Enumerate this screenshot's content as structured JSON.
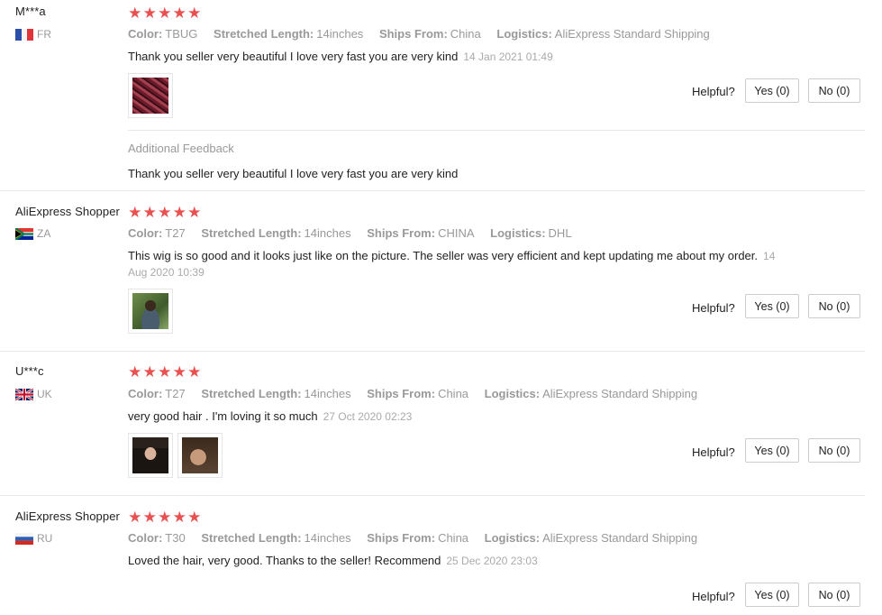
{
  "colors": {
    "star": "#e95151",
    "muted": "#999999",
    "text": "#222222"
  },
  "helpful_label": "Helpful?",
  "reviews": [
    {
      "user": "M***a",
      "country_code": "FR",
      "stars": 5,
      "color_key": "Color:",
      "color_value": "TBUG",
      "length_key": "Stretched Length:",
      "length_value": "14inches",
      "ships_key": "Ships From:",
      "ships_value": "China",
      "logistics_key": "Logistics:",
      "logistics_value": "AliExpress Standard Shipping",
      "text": "Thank you seller very beautiful I love very fast you are very kind",
      "time": "14 Jan 2021 01:49",
      "yes": "Yes (0)",
      "no": "No (0)",
      "additional_title": "Additional Feedback",
      "additional_text": "Thank you seller very beautiful I love very fast you are very kind"
    },
    {
      "user": "AliExpress Shopper",
      "country_code": "ZA",
      "stars": 5,
      "color_key": "Color:",
      "color_value": "T27",
      "length_key": "Stretched Length:",
      "length_value": "14inches",
      "ships_key": "Ships From:",
      "ships_value": "CHINA",
      "logistics_key": "Logistics:",
      "logistics_value": "DHL",
      "text": "This wig is so good and it looks just like on the picture. The seller was very efficient and kept updating me about my order.",
      "time": "14 Aug 2020 10:39",
      "yes": "Yes (0)",
      "no": "No (0)"
    },
    {
      "user": "U***c",
      "country_code": "UK",
      "stars": 5,
      "color_key": "Color:",
      "color_value": "T27",
      "length_key": "Stretched Length:",
      "length_value": "14inches",
      "ships_key": "Ships From:",
      "ships_value": "China",
      "logistics_key": "Logistics:",
      "logistics_value": "AliExpress Standard Shipping",
      "text": "very good hair . I'm loving it so much",
      "time": "27 Oct 2020 02:23",
      "yes": "Yes (0)",
      "no": "No (0)"
    },
    {
      "user": "AliExpress Shopper",
      "country_code": "RU",
      "stars": 5,
      "color_key": "Color:",
      "color_value": "T30",
      "length_key": "Stretched Length:",
      "length_value": "14inches",
      "ships_key": "Ships From:",
      "ships_value": "China",
      "logistics_key": "Logistics:",
      "logistics_value": "AliExpress Standard Shipping",
      "text": "Loved the hair, very good. Thanks to the seller! Recommend",
      "time": "25 Dec 2020 23:03",
      "yes": "Yes (0)",
      "no": "No (0)"
    }
  ]
}
